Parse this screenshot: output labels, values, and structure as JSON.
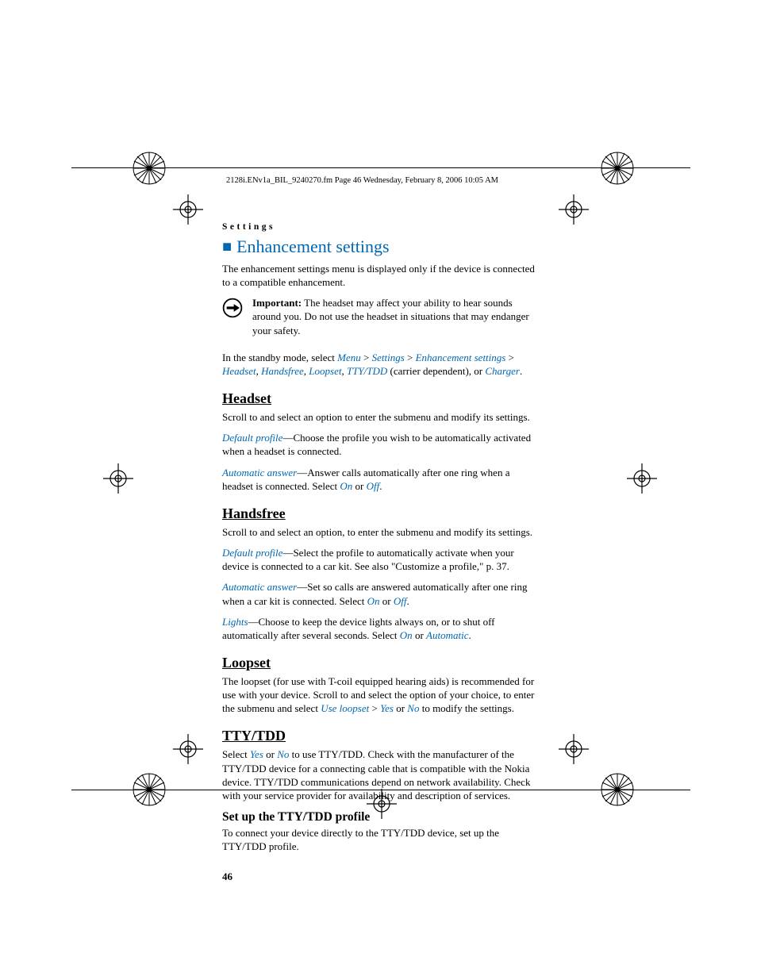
{
  "header_line": "2128i.ENv1a_BIL_9240270.fm  Page 46  Wednesday, February 8, 2006  10:05 AM",
  "running_head": "Settings",
  "h1": "Enhancement settings",
  "intro": "The enhancement settings menu is displayed only if the device is connected to a compatible enhancement.",
  "important_label": "Important:",
  "important_text": " The headset may affect your ability to hear sounds around you. Do not use the headset in situations that may endanger your safety.",
  "standby_pre": "In the standby mode, select ",
  "nav": {
    "menu": "Menu",
    "settings": "Settings",
    "enh": "Enhancement settings",
    "headset": "Headset",
    "handsfree": "Handsfree",
    "loopset": "Loopset",
    "tty": "TTY/TDD",
    "carrier": " (carrier dependent), or ",
    "charger": "Charger"
  },
  "gt": " > ",
  "comma": ", ",
  "period": ".",
  "headset_h": "Headset",
  "headset_p1": "Scroll to and select an option to enter the submenu and modify its settings.",
  "default_profile": "Default profile",
  "headset_dp": "—Choose the profile you wish to be automatically activated when a headset is connected.",
  "auto_answer": "Automatic answer",
  "headset_aa_pre": "—Answer calls automatically after one ring when a headset is connected. Select ",
  "on": "On",
  "off": "Off",
  "or": " or ",
  "handsfree_h": "Handsfree",
  "handsfree_p1": "Scroll to and select an option, to enter the submenu and modify its settings.",
  "handsfree_dp": "—Select the profile to automatically activate when your device is connected to a car kit. See also \"Customize a profile,\" p. 37.",
  "handsfree_aa_pre": "—Set so calls are answered automatically after one ring when a car kit is connected. Select ",
  "lights": "Lights",
  "lights_pre": "—Choose to keep the device lights always on, or to shut off automatically after several seconds. Select ",
  "automatic": "Automatic",
  "loopset_h": "Loopset",
  "loopset_p_pre": "The loopset (for use with T-coil equipped hearing aids) is recommended for use with your device. Scroll to and select the option of your choice, to enter the submenu and select ",
  "use_loopset": "Use loopset",
  "yes": "Yes",
  "no": "No",
  "loopset_p_post": " to modify the settings.",
  "tty_h": "TTY/TDD",
  "tty_p_pre": "Select ",
  "tty_p_post": " to use TTY/TDD. Check with the manufacturer of the TTY/TDD device for a connecting cable that is compatible with the Nokia device. TTY/TDD communications depend on network availability. Check with your service provider for availability and description of services.",
  "tty_setup_h": "Set up the TTY/TDD profile",
  "tty_setup_p": "To connect your device directly to the TTY/TDD device, set up the TTY/TDD profile.",
  "pagenum": "46"
}
